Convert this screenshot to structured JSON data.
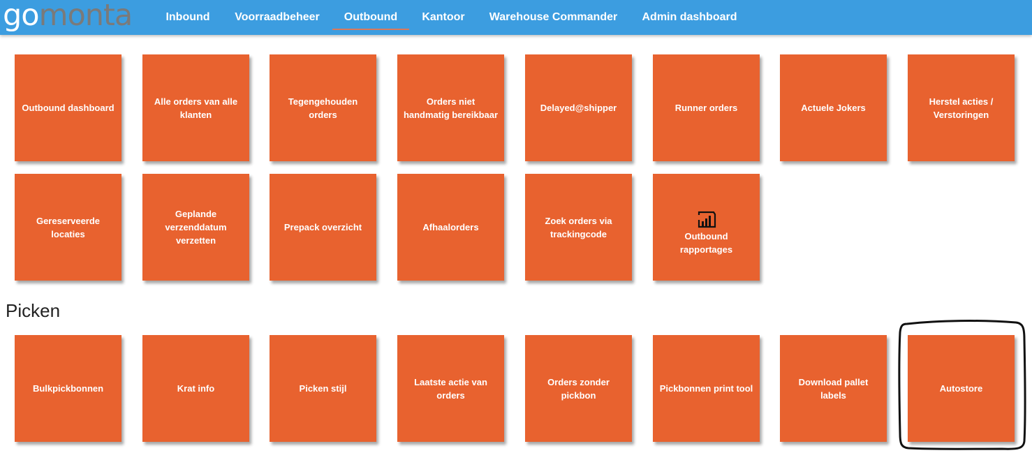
{
  "logo": {
    "part1": "go",
    "part2": "monta"
  },
  "nav": {
    "items": [
      {
        "label": "Inbound",
        "active": false
      },
      {
        "label": "Voorraadbeheer",
        "active": false
      },
      {
        "label": "Outbound",
        "active": true
      },
      {
        "label": "Kantoor",
        "active": false
      },
      {
        "label": "Warehouse Commander",
        "active": false
      },
      {
        "label": "Admin dashboard",
        "active": false
      }
    ]
  },
  "outbound_tiles": [
    {
      "label": "Outbound dashboard"
    },
    {
      "label": "Alle orders van alle klanten"
    },
    {
      "label": "Tegengehouden orders"
    },
    {
      "label": "Orders niet handmatig bereikbaar"
    },
    {
      "label": "Delayed@shipper"
    },
    {
      "label": "Runner orders"
    },
    {
      "label": "Actuele Jokers"
    },
    {
      "label": "Herstel acties / Verstoringen"
    },
    {
      "label": "Gereserveerde locaties"
    },
    {
      "label": "Geplande verzenddatum verzetten"
    },
    {
      "label": "Prepack overzicht"
    },
    {
      "label": "Afhaalorders"
    },
    {
      "label": "Zoek orders via trackingcode"
    },
    {
      "label": "Outbound rapportages",
      "icon": "power-bi-icon"
    }
  ],
  "picken": {
    "title": "Picken",
    "tiles": [
      {
        "label": "Bulkpickbonnen"
      },
      {
        "label": "Krat info"
      },
      {
        "label": "Picken stijl"
      },
      {
        "label": "Laatste actie van orders"
      },
      {
        "label": "Orders zonder pickbon"
      },
      {
        "label": "Pickbonnen print tool"
      },
      {
        "label": "Download pallet labels"
      },
      {
        "label": "Autostore"
      }
    ]
  },
  "colors": {
    "navbar": "#3c9de0",
    "tile": "#e8622f",
    "active_underline": "#d9795b",
    "logo_gray": "#7a7a7a"
  }
}
